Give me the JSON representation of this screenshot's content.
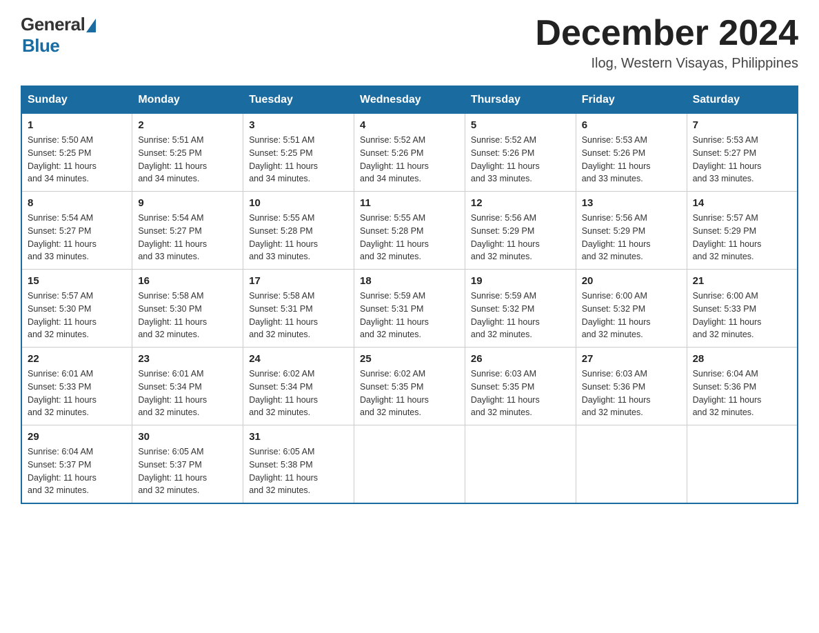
{
  "logo": {
    "general": "General",
    "blue": "Blue"
  },
  "title": "December 2024",
  "location": "Ilog, Western Visayas, Philippines",
  "days_of_week": [
    "Sunday",
    "Monday",
    "Tuesday",
    "Wednesday",
    "Thursday",
    "Friday",
    "Saturday"
  ],
  "weeks": [
    [
      {
        "day": "1",
        "sunrise": "5:50 AM",
        "sunset": "5:25 PM",
        "daylight": "11 hours and 34 minutes."
      },
      {
        "day": "2",
        "sunrise": "5:51 AM",
        "sunset": "5:25 PM",
        "daylight": "11 hours and 34 minutes."
      },
      {
        "day": "3",
        "sunrise": "5:51 AM",
        "sunset": "5:25 PM",
        "daylight": "11 hours and 34 minutes."
      },
      {
        "day": "4",
        "sunrise": "5:52 AM",
        "sunset": "5:26 PM",
        "daylight": "11 hours and 34 minutes."
      },
      {
        "day": "5",
        "sunrise": "5:52 AM",
        "sunset": "5:26 PM",
        "daylight": "11 hours and 33 minutes."
      },
      {
        "day": "6",
        "sunrise": "5:53 AM",
        "sunset": "5:26 PM",
        "daylight": "11 hours and 33 minutes."
      },
      {
        "day": "7",
        "sunrise": "5:53 AM",
        "sunset": "5:27 PM",
        "daylight": "11 hours and 33 minutes."
      }
    ],
    [
      {
        "day": "8",
        "sunrise": "5:54 AM",
        "sunset": "5:27 PM",
        "daylight": "11 hours and 33 minutes."
      },
      {
        "day": "9",
        "sunrise": "5:54 AM",
        "sunset": "5:27 PM",
        "daylight": "11 hours and 33 minutes."
      },
      {
        "day": "10",
        "sunrise": "5:55 AM",
        "sunset": "5:28 PM",
        "daylight": "11 hours and 33 minutes."
      },
      {
        "day": "11",
        "sunrise": "5:55 AM",
        "sunset": "5:28 PM",
        "daylight": "11 hours and 32 minutes."
      },
      {
        "day": "12",
        "sunrise": "5:56 AM",
        "sunset": "5:29 PM",
        "daylight": "11 hours and 32 minutes."
      },
      {
        "day": "13",
        "sunrise": "5:56 AM",
        "sunset": "5:29 PM",
        "daylight": "11 hours and 32 minutes."
      },
      {
        "day": "14",
        "sunrise": "5:57 AM",
        "sunset": "5:29 PM",
        "daylight": "11 hours and 32 minutes."
      }
    ],
    [
      {
        "day": "15",
        "sunrise": "5:57 AM",
        "sunset": "5:30 PM",
        "daylight": "11 hours and 32 minutes."
      },
      {
        "day": "16",
        "sunrise": "5:58 AM",
        "sunset": "5:30 PM",
        "daylight": "11 hours and 32 minutes."
      },
      {
        "day": "17",
        "sunrise": "5:58 AM",
        "sunset": "5:31 PM",
        "daylight": "11 hours and 32 minutes."
      },
      {
        "day": "18",
        "sunrise": "5:59 AM",
        "sunset": "5:31 PM",
        "daylight": "11 hours and 32 minutes."
      },
      {
        "day": "19",
        "sunrise": "5:59 AM",
        "sunset": "5:32 PM",
        "daylight": "11 hours and 32 minutes."
      },
      {
        "day": "20",
        "sunrise": "6:00 AM",
        "sunset": "5:32 PM",
        "daylight": "11 hours and 32 minutes."
      },
      {
        "day": "21",
        "sunrise": "6:00 AM",
        "sunset": "5:33 PM",
        "daylight": "11 hours and 32 minutes."
      }
    ],
    [
      {
        "day": "22",
        "sunrise": "6:01 AM",
        "sunset": "5:33 PM",
        "daylight": "11 hours and 32 minutes."
      },
      {
        "day": "23",
        "sunrise": "6:01 AM",
        "sunset": "5:34 PM",
        "daylight": "11 hours and 32 minutes."
      },
      {
        "day": "24",
        "sunrise": "6:02 AM",
        "sunset": "5:34 PM",
        "daylight": "11 hours and 32 minutes."
      },
      {
        "day": "25",
        "sunrise": "6:02 AM",
        "sunset": "5:35 PM",
        "daylight": "11 hours and 32 minutes."
      },
      {
        "day": "26",
        "sunrise": "6:03 AM",
        "sunset": "5:35 PM",
        "daylight": "11 hours and 32 minutes."
      },
      {
        "day": "27",
        "sunrise": "6:03 AM",
        "sunset": "5:36 PM",
        "daylight": "11 hours and 32 minutes."
      },
      {
        "day": "28",
        "sunrise": "6:04 AM",
        "sunset": "5:36 PM",
        "daylight": "11 hours and 32 minutes."
      }
    ],
    [
      {
        "day": "29",
        "sunrise": "6:04 AM",
        "sunset": "5:37 PM",
        "daylight": "11 hours and 32 minutes."
      },
      {
        "day": "30",
        "sunrise": "6:05 AM",
        "sunset": "5:37 PM",
        "daylight": "11 hours and 32 minutes."
      },
      {
        "day": "31",
        "sunrise": "6:05 AM",
        "sunset": "5:38 PM",
        "daylight": "11 hours and 32 minutes."
      },
      null,
      null,
      null,
      null
    ]
  ],
  "labels": {
    "sunrise": "Sunrise:",
    "sunset": "Sunset:",
    "daylight": "Daylight:"
  }
}
